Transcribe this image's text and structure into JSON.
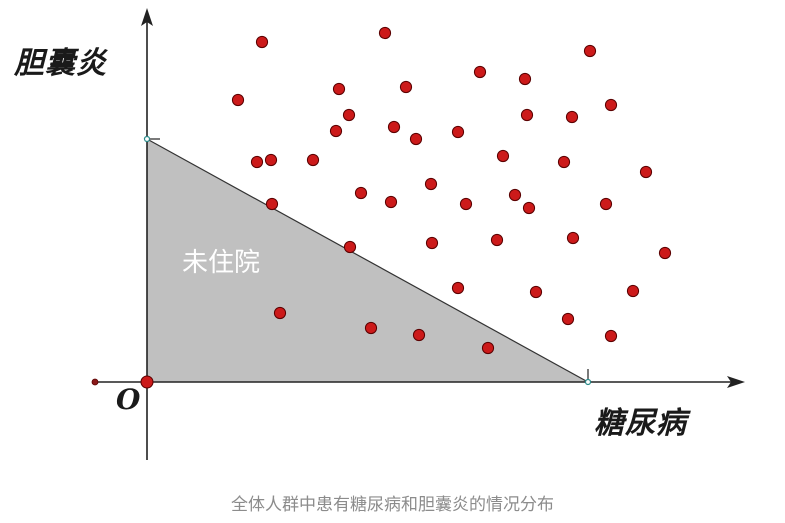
{
  "diagram": {
    "y_axis_label": "胆囊炎",
    "x_axis_label": "糖尿病",
    "origin_label": "O",
    "region_label": "未住院",
    "caption": "全体人群中患有糖尿病和胆囊炎的情况分布",
    "colors": {
      "dot_fill": "#cc1a1a",
      "dot_stroke": "#5a0000",
      "region_fill": "#c0c0c0",
      "axis": "#222222"
    }
  }
}
